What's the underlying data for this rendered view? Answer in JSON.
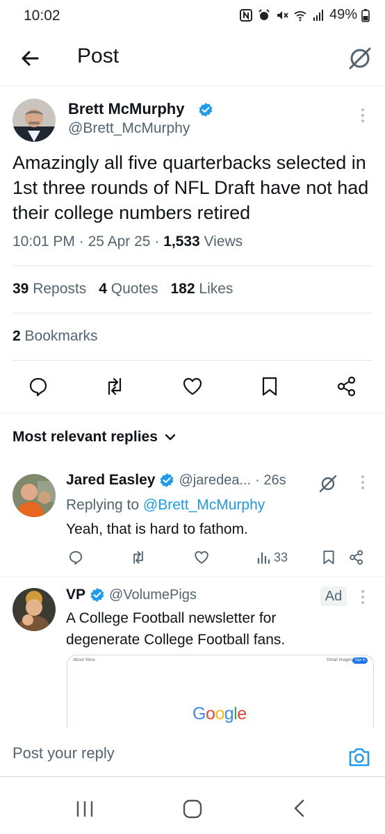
{
  "status_bar": {
    "time": "10:02",
    "battery": "49%"
  },
  "header": {
    "title": "Post"
  },
  "tweet": {
    "author_name": "Brett McMurphy",
    "author_handle": "@Brett_McMurphy",
    "text": "Amazingly all five quarterbacks selected in 1st three rounds of NFL Draft have not had their college numbers retired",
    "time": "10:01 PM",
    "date": "25 Apr 25",
    "views_count": "1,533",
    "views_label": "Views",
    "reposts_count": "39",
    "reposts_label": "Reposts",
    "quotes_count": "4",
    "quotes_label": "Quotes",
    "likes_count": "182",
    "likes_label": "Likes",
    "bookmarks_count": "2",
    "bookmarks_label": "Bookmarks"
  },
  "replies": {
    "heading": "Most relevant replies",
    "items": [
      {
        "name": "Jared Easley",
        "handle": "@jaredea...",
        "time": "· 26s",
        "replying_to_prefix": "Replying to",
        "replying_to_handle": "@Brett_McMurphy",
        "text": "Yeah, that is hard to fathom.",
        "views": "33"
      }
    ]
  },
  "ad": {
    "name": "VP",
    "handle": "@VolumePigs",
    "badge": "Ad",
    "text": "A College Football newsletter for degenerate College Football fans.",
    "card": {
      "top_left": "About   Store",
      "top_right": "Gmail   Images",
      "signin": "Sign in",
      "logo": [
        "G",
        "o",
        "o",
        "g",
        "l",
        "e"
      ]
    }
  },
  "composer": {
    "placeholder": "Post your reply"
  },
  "colors": {
    "accent": "#1d9bf0",
    "text": "#0f1419",
    "secondary": "#536471"
  }
}
